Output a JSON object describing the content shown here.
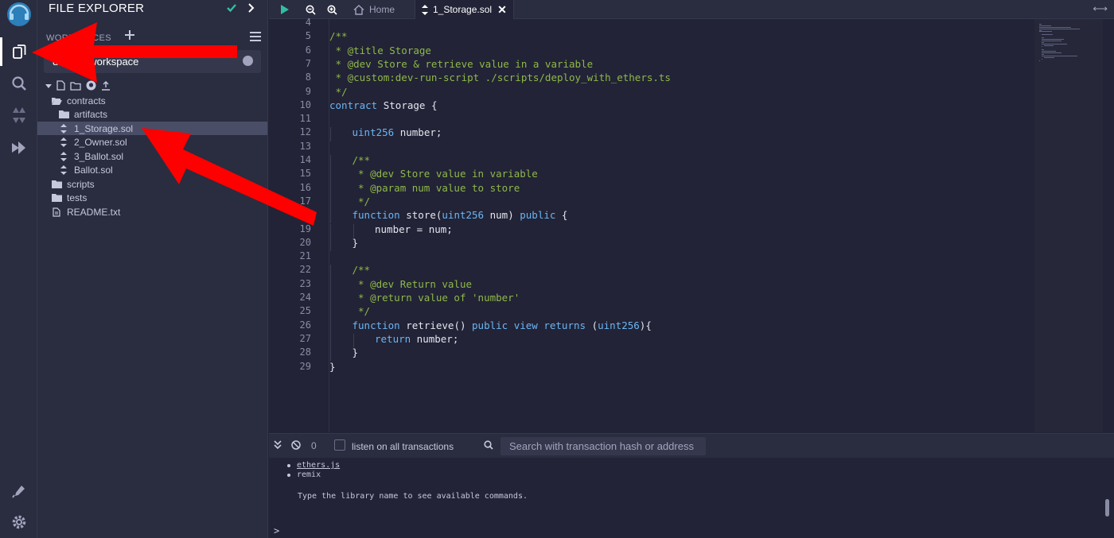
{
  "panel": {
    "title": "FILE EXPLORER",
    "workspaces_label": "WORKSPACES",
    "workspace_selected": "default_workspace"
  },
  "tree": [
    {
      "label": "contracts",
      "kind": "folder-open",
      "depth": 0,
      "selected": false
    },
    {
      "label": "artifacts",
      "kind": "folder",
      "depth": 1,
      "selected": false
    },
    {
      "label": "1_Storage.sol",
      "kind": "solidity",
      "depth": 1,
      "selected": true
    },
    {
      "label": "2_Owner.sol",
      "kind": "solidity",
      "depth": 1,
      "selected": false
    },
    {
      "label": "3_Ballot.sol",
      "kind": "solidity",
      "depth": 1,
      "selected": false
    },
    {
      "label": "Ballot.sol",
      "kind": "solidity",
      "depth": 1,
      "selected": false
    },
    {
      "label": "scripts",
      "kind": "folder",
      "depth": 0,
      "selected": false
    },
    {
      "label": "tests",
      "kind": "folder",
      "depth": 0,
      "selected": false
    },
    {
      "label": "README.txt",
      "kind": "file",
      "depth": 0,
      "selected": false
    }
  ],
  "tabs": [
    {
      "label": "Home",
      "icon": "home-icon",
      "active": false
    },
    {
      "label": "1_Storage.sol",
      "icon": "solidity-icon",
      "active": true
    }
  ],
  "editor": {
    "lines": [
      {
        "n": "4",
        "indent": 0,
        "tokens": []
      },
      {
        "n": "5",
        "indent": 0,
        "tokens": [
          {
            "t": "/**",
            "c": "cm"
          }
        ]
      },
      {
        "n": "6",
        "indent": 0,
        "tokens": [
          {
            "t": " * @title Storage",
            "c": "cm"
          }
        ]
      },
      {
        "n": "7",
        "indent": 0,
        "tokens": [
          {
            "t": " * @dev Store & retrieve value in a variable",
            "c": "cm"
          }
        ]
      },
      {
        "n": "8",
        "indent": 0,
        "tokens": [
          {
            "t": " * @custom:dev-run-script ./scripts/deploy_with_ethers.ts",
            "c": "cm"
          }
        ]
      },
      {
        "n": "9",
        "indent": 0,
        "tokens": [
          {
            "t": " */",
            "c": "cm"
          }
        ]
      },
      {
        "n": "10",
        "indent": 0,
        "tokens": [
          {
            "t": "contract",
            "c": "kw"
          },
          {
            "t": " Storage {",
            "c": "tx"
          }
        ]
      },
      {
        "n": "11",
        "indent": 0,
        "tokens": []
      },
      {
        "n": "12",
        "indent": 1,
        "tokens": [
          {
            "t": "uint256",
            "c": "ty"
          },
          {
            "t": " number;",
            "c": "tx"
          }
        ]
      },
      {
        "n": "13",
        "indent": 0,
        "tokens": []
      },
      {
        "n": "14",
        "indent": 1,
        "tokens": [
          {
            "t": "/**",
            "c": "cm"
          }
        ]
      },
      {
        "n": "15",
        "indent": 1,
        "tokens": [
          {
            "t": " * @dev Store value in variable",
            "c": "cm"
          }
        ]
      },
      {
        "n": "16",
        "indent": 1,
        "tokens": [
          {
            "t": " * @param num value to store",
            "c": "cm"
          }
        ]
      },
      {
        "n": "17",
        "indent": 1,
        "tokens": [
          {
            "t": " */",
            "c": "cm"
          }
        ]
      },
      {
        "n": "18",
        "indent": 1,
        "tokens": [
          {
            "t": "function",
            "c": "kw"
          },
          {
            "t": " store(",
            "c": "tx"
          },
          {
            "t": "uint256",
            "c": "ty"
          },
          {
            "t": " num) ",
            "c": "tx"
          },
          {
            "t": "public",
            "c": "kw"
          },
          {
            "t": " {",
            "c": "tx"
          }
        ]
      },
      {
        "n": "19",
        "indent": 2,
        "tokens": [
          {
            "t": "number = num;",
            "c": "tx"
          }
        ]
      },
      {
        "n": "20",
        "indent": 1,
        "tokens": [
          {
            "t": "}",
            "c": "tx"
          }
        ]
      },
      {
        "n": "21",
        "indent": 0,
        "tokens": []
      },
      {
        "n": "22",
        "indent": 1,
        "tokens": [
          {
            "t": "/**",
            "c": "cm"
          }
        ]
      },
      {
        "n": "23",
        "indent": 1,
        "tokens": [
          {
            "t": " * @dev Return value",
            "c": "cm"
          }
        ]
      },
      {
        "n": "24",
        "indent": 1,
        "tokens": [
          {
            "t": " * @return value of 'number'",
            "c": "cm"
          }
        ]
      },
      {
        "n": "25",
        "indent": 1,
        "tokens": [
          {
            "t": " */",
            "c": "cm"
          }
        ]
      },
      {
        "n": "26",
        "indent": 1,
        "tokens": [
          {
            "t": "function",
            "c": "kw"
          },
          {
            "t": " retrieve() ",
            "c": "tx"
          },
          {
            "t": "public",
            "c": "kw"
          },
          {
            "t": " ",
            "c": "tx"
          },
          {
            "t": "view",
            "c": "kw"
          },
          {
            "t": " ",
            "c": "tx"
          },
          {
            "t": "returns",
            "c": "kw"
          },
          {
            "t": " (",
            "c": "tx"
          },
          {
            "t": "uint256",
            "c": "ty"
          },
          {
            "t": "){",
            "c": "tx"
          }
        ]
      },
      {
        "n": "27",
        "indent": 2,
        "tokens": [
          {
            "t": "return",
            "c": "kw"
          },
          {
            "t": " number;",
            "c": "tx"
          }
        ]
      },
      {
        "n": "28",
        "indent": 1,
        "tokens": [
          {
            "t": "}",
            "c": "tx"
          }
        ]
      },
      {
        "n": "29",
        "indent": 0,
        "tokens": [
          {
            "t": "}",
            "c": "tx"
          }
        ]
      }
    ]
  },
  "terminal": {
    "count": "0",
    "listen_label": "listen on all transactions",
    "search_placeholder": "Search with transaction hash or address",
    "lines": [
      {
        "text": "ethers.js",
        "bullet": true,
        "underline": true
      },
      {
        "text": "remix",
        "bullet": true,
        "underline": false
      },
      {
        "text": "",
        "bullet": false,
        "underline": false
      },
      {
        "text": "Type the library name to see available commands.",
        "bullet": false,
        "underline": false
      }
    ],
    "prompt": ">"
  },
  "colors": {
    "background": "#222336",
    "panel": "#2a2c3f",
    "accent_green": "#2fbfa0",
    "annotation_red": "#ff0000"
  }
}
